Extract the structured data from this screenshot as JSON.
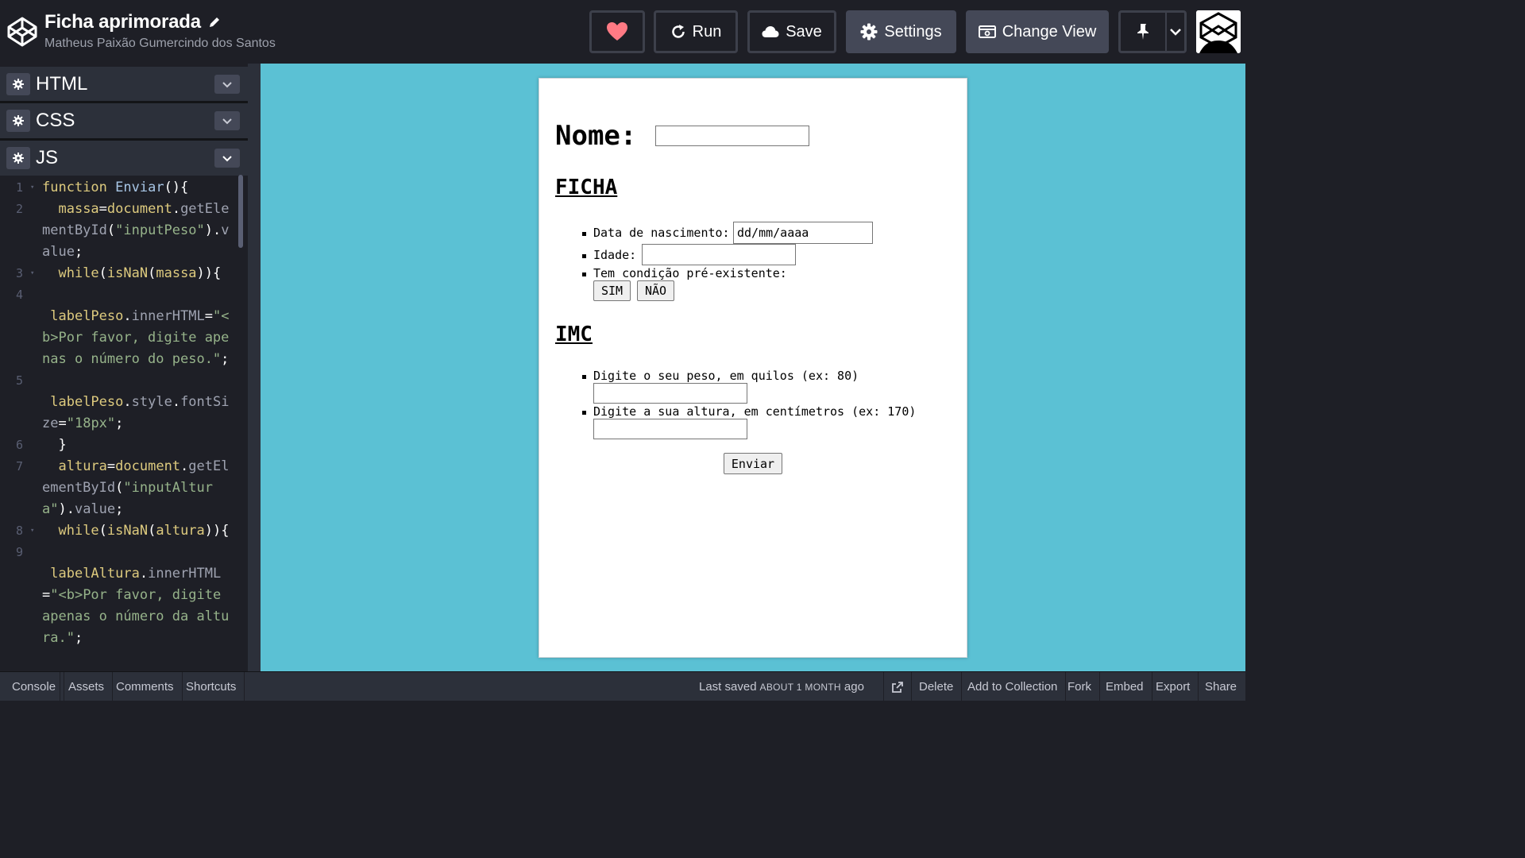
{
  "header": {
    "pen_title": "Ficha aprimorada",
    "author": "Matheus Paixão Gumercindo dos Santos",
    "run_label": "Run",
    "save_label": "Save",
    "settings_label": "Settings",
    "change_view_label": "Change View"
  },
  "panels": {
    "html": "HTML",
    "css": "CSS",
    "js": "JS"
  },
  "code": [
    {
      "n": "1",
      "fold": true,
      "html": "<span class='kw'>function</span> <span class='fn'>Enviar</span><span class='pl'>(){</span>"
    },
    {
      "n": "2",
      "fold": false,
      "html": "  <span class='var'>massa</span><span class='pl'>=</span><span class='var'>document</span><span class='pl'>.</span><span class='prop'>getElementById</span><span class='pl'>(</span><span class='str'>\"inputPeso\"</span><span class='pl'>).</span><span class='prop'>value</span><span class='pl'>;</span>"
    },
    {
      "n": "3",
      "fold": true,
      "html": "  <span class='var'>while</span><span class='pl'>(</span><span class='var'>isNaN</span><span class='pl'>(</span><span class='var'>massa</span><span class='pl'>)){</span>"
    },
    {
      "n": "4",
      "fold": false,
      "html": ""
    },
    {
      "n": "",
      "fold": false,
      "html": " <span class='var'>labelPeso</span><span class='pl'>.</span><span class='prop'>innerHTML</span><span class='pl'>=</span><span class='str'>\"&lt;b&gt;Por favor, digite apenas o número do peso.\"</span><span class='pl'>;</span>"
    },
    {
      "n": "5",
      "fold": false,
      "html": ""
    },
    {
      "n": "",
      "fold": false,
      "html": " <span class='var'>labelPeso</span><span class='pl'>.</span><span class='prop'>style</span><span class='pl'>.</span><span class='prop'>fontSize</span><span class='pl'>=</span><span class='str'>\"18px\"</span><span class='pl'>;</span>"
    },
    {
      "n": "6",
      "fold": false,
      "html": "  <span class='pl'>}</span>"
    },
    {
      "n": "7",
      "fold": false,
      "html": "  <span class='var'>altura</span><span class='pl'>=</span><span class='var'>document</span><span class='pl'>.</span><span class='prop'>getElementById</span><span class='pl'>(</span><span class='str'>\"inputAltura\"</span><span class='pl'>).</span><span class='prop'>value</span><span class='pl'>;</span>"
    },
    {
      "n": "8",
      "fold": true,
      "html": "  <span class='var'>while</span><span class='pl'>(</span><span class='var'>isNaN</span><span class='pl'>(</span><span class='var'>altura</span><span class='pl'>)){</span>"
    },
    {
      "n": "9",
      "fold": false,
      "html": ""
    },
    {
      "n": "",
      "fold": false,
      "html": " <span class='var'>labelAltura</span><span class='pl'>.</span><span class='prop'>innerHTML</span><span class='pl'>=</span><span class='str'>\"&lt;b&gt;Por favor, digite apenas o número da altura.\"</span><span class='pl'>;</span>"
    }
  ],
  "preview": {
    "name_label": "Nome:",
    "ficha_title": "FICHA",
    "birth_label": "Data de nascimento:",
    "birth_placeholder": "dd/mm/aaaa",
    "age_label": "Idade:",
    "condition_label": "Tem condição pré-existente:",
    "yes_label": "SIM",
    "no_label": "NÃO",
    "imc_title": "IMC",
    "weight_label": "Digite o seu peso, em quilos (ex: 80)",
    "height_label": "Digite a sua altura, em centímetros (ex: 170)",
    "submit_label": "Enviar"
  },
  "footer": {
    "console": "Console",
    "assets": "Assets",
    "comments": "Comments",
    "shortcuts": "Shortcuts",
    "last_saved_prefix": "Last saved",
    "last_saved_time": "ABOUT 1 MONTH",
    "last_saved_suffix": "ago",
    "delete": "Delete",
    "add_to_collection": "Add to Collection",
    "fork": "Fork",
    "embed": "Embed",
    "export": "Export",
    "share": "Share"
  },
  "colors": {
    "preview_bg": "#5bc1d4",
    "heart": "#ff7a84"
  }
}
